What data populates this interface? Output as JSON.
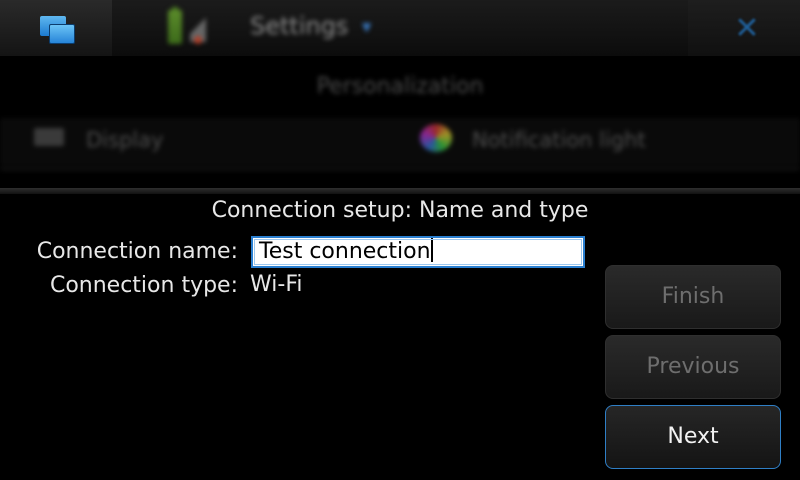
{
  "background": {
    "app_title": "Settings",
    "section": "Personalization",
    "items": [
      {
        "label": "Display"
      },
      {
        "label": "Notification light"
      }
    ]
  },
  "dialog": {
    "title": "Connection setup: Name and type",
    "name_label": "Connection name:",
    "name_value": "Test connection",
    "type_label": "Connection type:",
    "type_value": "Wi-Fi",
    "buttons": {
      "finish": "Finish",
      "previous": "Previous",
      "next": "Next"
    }
  },
  "colors": {
    "accent": "#2a7fd0",
    "disabled_text": "#6e6e6e"
  },
  "icons": [
    "task-switcher-icon",
    "battery-icon",
    "signal-icon",
    "dropdown-arrow-icon",
    "close-icon",
    "display-icon",
    "notification-light-icon"
  ]
}
